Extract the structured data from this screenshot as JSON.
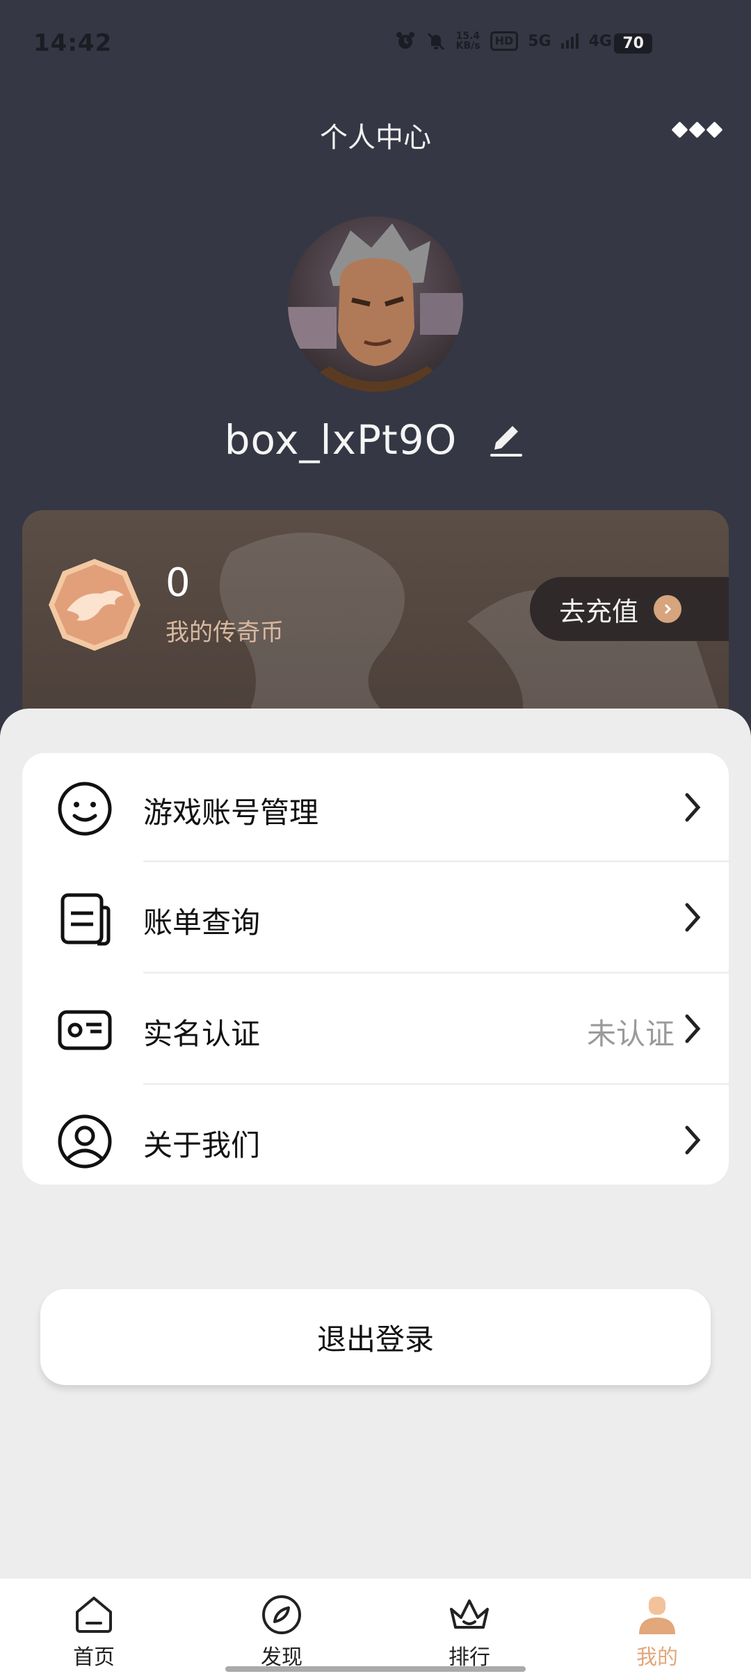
{
  "status_bar": {
    "time": "14:42",
    "net_speed_value": "15.4",
    "net_speed_unit": "KB/s",
    "hd_badge": "HD",
    "signal_1": "5G",
    "signal_2": "4G",
    "battery": "70"
  },
  "header": {
    "title": "个人中心"
  },
  "profile": {
    "username": "box_lxPt9O"
  },
  "coin_card": {
    "value": "0",
    "label": "我的传奇币",
    "recharge_label": "去充值"
  },
  "menu": {
    "items": [
      {
        "label": "游戏账号管理",
        "value": "",
        "icon": "smiley-icon"
      },
      {
        "label": "账单查询",
        "value": "",
        "icon": "document-icon"
      },
      {
        "label": "实名认证",
        "value": "未认证",
        "icon": "id-card-icon"
      },
      {
        "label": "关于我们",
        "value": "",
        "icon": "user-circle-icon"
      }
    ]
  },
  "logout": {
    "label": "退出登录"
  },
  "tabs": [
    {
      "label": "首页",
      "icon": "home-icon",
      "active": false
    },
    {
      "label": "发现",
      "icon": "compass-icon",
      "active": false
    },
    {
      "label": "排行",
      "icon": "crown-icon",
      "active": false
    },
    {
      "label": "我的",
      "icon": "profile-icon",
      "active": true
    }
  ],
  "colors": {
    "header_bg": "#353744",
    "accent": "#e2a77a",
    "coin_card_bg": "#5b4e46"
  }
}
